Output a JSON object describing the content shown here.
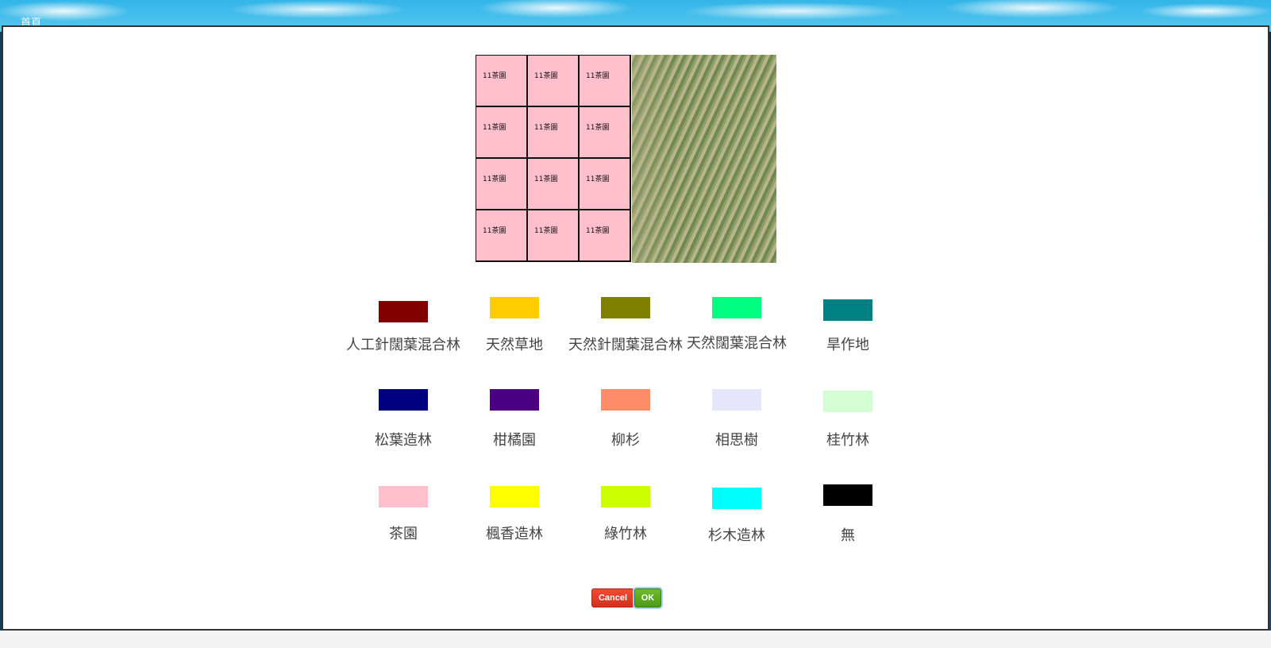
{
  "topbar": {
    "home_label": "首頁"
  },
  "grid": {
    "cells": [
      "11茶園",
      "11茶園",
      "11茶園",
      "11茶園",
      "11茶園",
      "11茶園",
      "11茶園",
      "11茶園",
      "11茶園",
      "11茶園",
      "11茶園",
      "11茶園"
    ],
    "cell_color": "#ffc0cb"
  },
  "legend": {
    "items": [
      {
        "label": "人工針闊葉混合林",
        "color": "#800000"
      },
      {
        "label": "天然草地",
        "color": "#ffcc00"
      },
      {
        "label": "天然針闊葉混合林",
        "color": "#808000"
      },
      {
        "label": "天然闊葉混合林",
        "color": "#00ff80"
      },
      {
        "label": "旱作地",
        "color": "#008080"
      },
      {
        "label": "松葉造林",
        "color": "#000080"
      },
      {
        "label": "柑橘園",
        "color": "#4b0082"
      },
      {
        "label": "柳杉",
        "color": "#ff8c69"
      },
      {
        "label": "相思樹",
        "color": "#e6e6fa"
      },
      {
        "label": "桂竹林",
        "color": "#d4ffd4"
      },
      {
        "label": "茶園",
        "color": "#ffc0cb"
      },
      {
        "label": "楓香造林",
        "color": "#ffff00"
      },
      {
        "label": "綠竹林",
        "color": "#ccff00"
      },
      {
        "label": "杉木造林",
        "color": "#00ffff"
      },
      {
        "label": "無",
        "color": "#000000"
      }
    ]
  },
  "buttons": {
    "cancel_label": "Cancel",
    "ok_label": "OK"
  }
}
